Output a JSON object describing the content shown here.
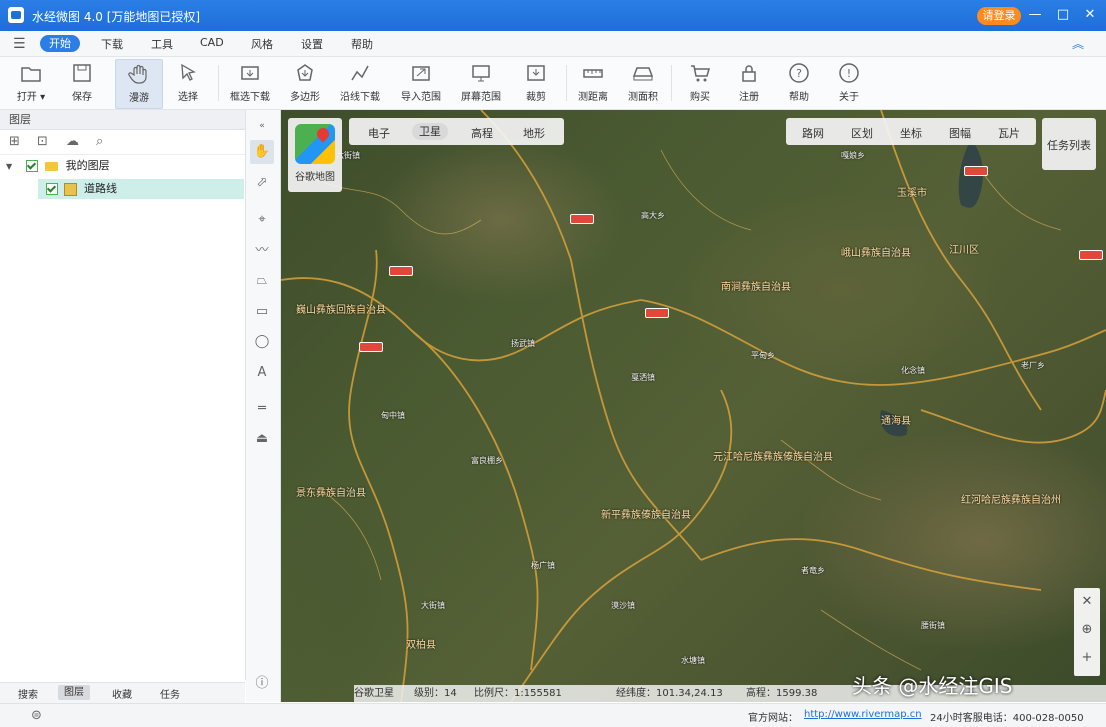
{
  "app": {
    "title": "水经微图 4.0 [万能地图已授权]",
    "login_label": "请登录",
    "window_controls": {
      "minimize": "—",
      "maximize": "□",
      "close": "✕"
    }
  },
  "menu": {
    "items": [
      "开始",
      "下载",
      "工具",
      "CAD",
      "风格",
      "设置",
      "帮助"
    ],
    "active": "开始"
  },
  "toolbar": {
    "items": [
      {
        "label": "打开 ▾",
        "icon": "folder-icon"
      },
      {
        "label": "保存",
        "icon": "save-icon"
      },
      {
        "label": "漫游",
        "icon": "hand-icon"
      },
      {
        "label": "选择",
        "icon": "pointer-icon"
      },
      {
        "label": "框选下载",
        "icon": "box-download-icon"
      },
      {
        "label": "多边形",
        "icon": "polygon-icon"
      },
      {
        "label": "沿线下载",
        "icon": "line-download-icon"
      },
      {
        "label": "导入范围",
        "icon": "import-icon"
      },
      {
        "label": "屏幕范围",
        "icon": "screen-icon"
      },
      {
        "label": "裁剪",
        "icon": "crop-icon"
      },
      {
        "label": "测距离",
        "icon": "ruler-icon"
      },
      {
        "label": "测面积",
        "icon": "area-icon"
      },
      {
        "label": "购买",
        "icon": "cart-icon"
      },
      {
        "label": "注册",
        "icon": "lock-icon"
      },
      {
        "label": "帮助",
        "icon": "help-icon"
      },
      {
        "label": "关于",
        "icon": "info-icon"
      }
    ],
    "active": "漫游"
  },
  "left_panel": {
    "header": "图层",
    "tree": [
      {
        "label": "我的图层",
        "type": "folder",
        "checked": true
      },
      {
        "label": "道路线",
        "type": "layer",
        "checked": true,
        "selected": true
      }
    ],
    "bottom_tabs": [
      "搜索",
      "图层",
      "收藏",
      "任务"
    ],
    "active_tab": "图层"
  },
  "map": {
    "type_tabs": [
      "电子",
      "卫星",
      "高程",
      "地形"
    ],
    "active_type": "卫星",
    "source_label": "谷歌地图",
    "info_tabs": [
      "路网",
      "区划",
      "坐标",
      "图幅",
      "瓦片"
    ],
    "task_list_label": "任务列表",
    "zoom_controls": {
      "fit": "✕",
      "locate": "⊕",
      "zoom_in": "+"
    },
    "county_labels": [
      "巍山彝族回族自治县",
      "南涧彝族自治县",
      "景东彝族自治县",
      "元江哈尼族彝族傣族自治县",
      "峨山彝族自治县",
      "新平彝族傣族自治县",
      "双柏县",
      "红河哈尼族彝族自治州",
      "玉溪市",
      "通海县",
      "江川区"
    ],
    "place_labels": [
      "六街镇",
      "扬武镇",
      "戛洒镇",
      "富良棚乡",
      "平甸乡",
      "嘎娘乡",
      "化念镇",
      "甸中镇",
      "大街镇",
      "漠沙镇",
      "水塘镇",
      "者竜乡",
      "老厂乡",
      "腰街镇",
      "杨广镇",
      "高大乡"
    ],
    "road_shields": [
      "G213",
      "G323",
      "S218",
      "G8511"
    ],
    "status": {
      "source": "谷歌卫星",
      "level": "级别：14",
      "scale": "比例尺：1:155581",
      "coords": "经纬度：101.34,24.13",
      "altitude": "高程：1599.38"
    },
    "watermark": "头条 @水经注GIS"
  },
  "statusbar": {
    "site_label": "官方网站：",
    "site_url": "http://www.rivermap.cn",
    "phone": "24小时客服电话：400-028-0050"
  }
}
